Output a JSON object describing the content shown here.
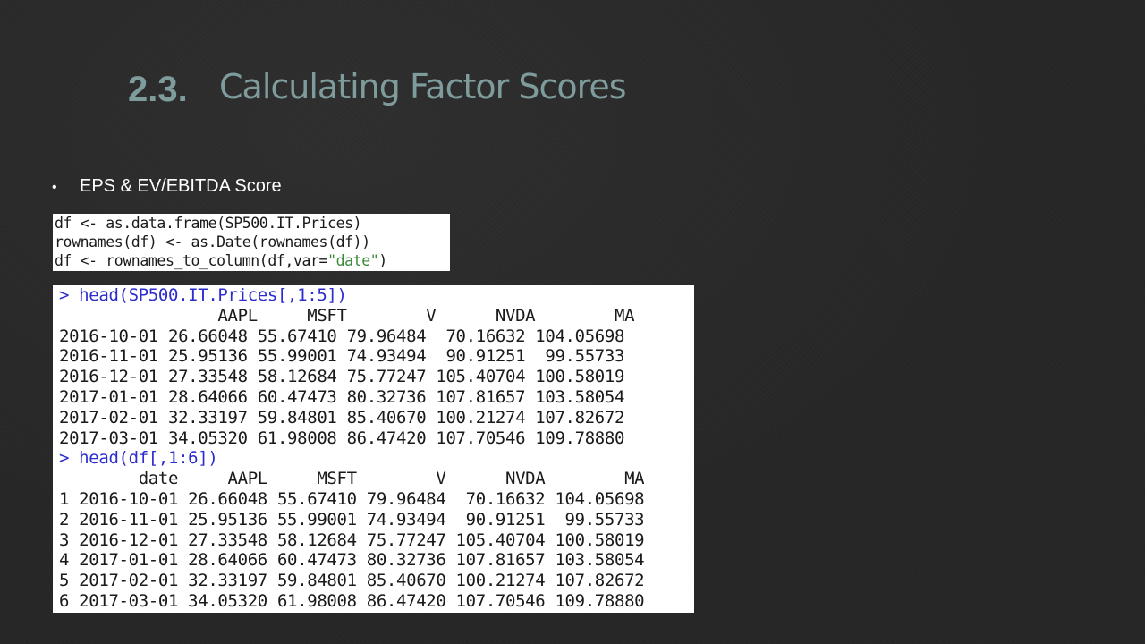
{
  "slide": {
    "title_number": "2.3.",
    "title_text": "Calculating Factor Scores",
    "bullet_marker": "•",
    "bullet_text": "EPS & EV/EBITDA Score"
  },
  "code_snippet": {
    "line1": "df <- as.data.frame(SP500.IT.Prices)",
    "line2": "rownames(df) <- as.Date(rownames(df))",
    "line3_prefix": "df <- rownames_to_column(df,var=",
    "line3_string": "\"date\"",
    "line3_suffix": ")"
  },
  "console": {
    "cmd1": "> head(SP500.IT.Prices[,1:5])",
    "header1": "                AAPL     MSFT        V      NVDA        MA",
    "rows1": [
      "2016-10-01 26.66048 55.67410 79.96484  70.16632 104.05698",
      "2016-11-01 25.95136 55.99001 74.93494  90.91251  99.55733",
      "2016-12-01 27.33548 58.12684 75.77247 105.40704 100.58019",
      "2017-01-01 28.64066 60.47473 80.32736 107.81657 103.58054",
      "2017-02-01 32.33197 59.84801 85.40670 100.21274 107.82672",
      "2017-03-01 34.05320 61.98008 86.47420 107.70546 109.78880"
    ],
    "cmd2": "> head(df[,1:6])",
    "header2": "        date     AAPL     MSFT        V      NVDA        MA",
    "rows2": [
      "1 2016-10-01 26.66048 55.67410 79.96484  70.16632 104.05698",
      "2 2016-11-01 25.95136 55.99001 74.93494  90.91251  99.55733",
      "3 2016-12-01 27.33548 58.12684 75.77247 105.40704 100.58019",
      "4 2017-01-01 28.64066 60.47473 80.32736 107.81657 103.58054",
      "5 2017-02-01 32.33197 59.84801 85.40670 100.21274 107.82672",
      "6 2017-03-01 34.05320 61.98008 86.47420 107.70546 109.78880"
    ]
  },
  "colors": {
    "background": "#262626",
    "title": "#7f9c9c",
    "console_command": "#2c2ccf",
    "code_string": "#3a8a3a"
  }
}
